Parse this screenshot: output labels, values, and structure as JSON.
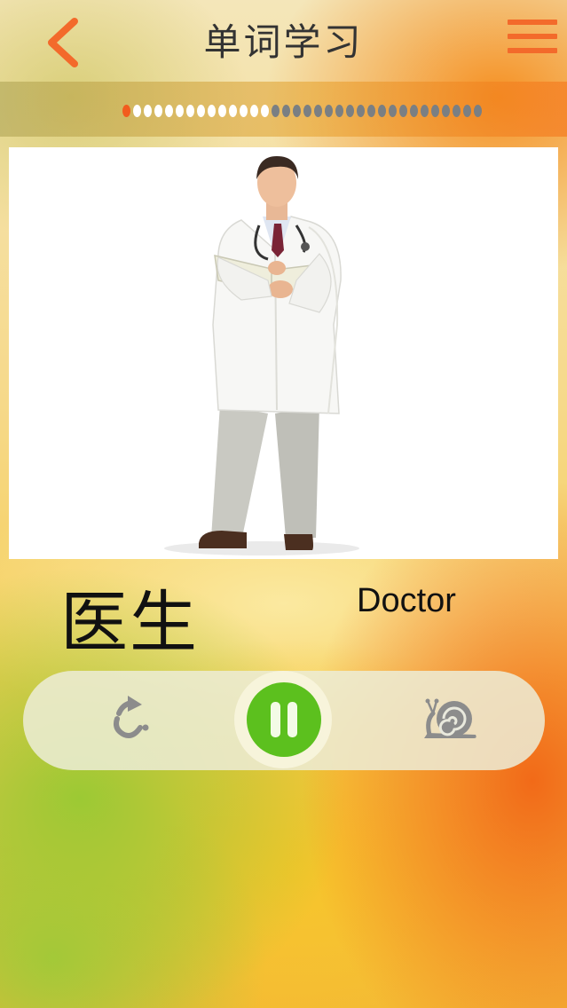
{
  "header": {
    "title": "单词学习",
    "back_icon": "chevron-left-icon",
    "menu_icon": "hamburger-menu-icon",
    "accent_color": "#f36a2b"
  },
  "progress": {
    "current_index": 1,
    "completed": 14,
    "total": 34,
    "colors": {
      "current": "#f25c1e",
      "done": "#ffffff",
      "todo": "#7a7f83"
    }
  },
  "word": {
    "chinese": "医生",
    "english": "Doctor",
    "picture": "doctor-photo"
  },
  "controls": {
    "repeat_icon": "repeat-icon",
    "pause_icon": "pause-icon",
    "slow_icon": "snail-icon",
    "play_color": "#5cc01e"
  }
}
